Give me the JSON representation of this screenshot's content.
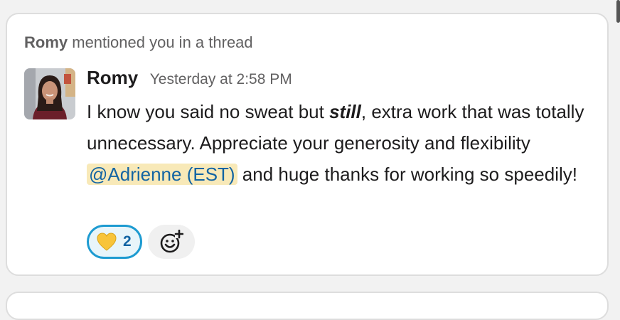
{
  "context": {
    "name": "Romy",
    "action": "mentioned you in a thread"
  },
  "message": {
    "author": "Romy",
    "timestamp": "Yesterday at 2:58 PM",
    "text_part1": "I know you said no sweat but ",
    "text_emphasis": "still",
    "text_part2": ", extra work that was totally unnecessary. Appreciate your generosity and flexibility ",
    "mention": "@Adrienne (EST)",
    "text_part3": " and huge thanks for working so speedily!"
  },
  "reactions": [
    {
      "emoji": "yellow-heart",
      "count": "2",
      "selected": true
    }
  ],
  "icons": {
    "add_reaction": "add-reaction-icon",
    "reaction_emoji": "yellow-heart-icon"
  },
  "colors": {
    "mention_bg": "#f8e9b8",
    "mention_text": "#1264a3",
    "reaction_selected_border": "#1d9bd1",
    "reaction_selected_bg": "#e8f5fa"
  }
}
